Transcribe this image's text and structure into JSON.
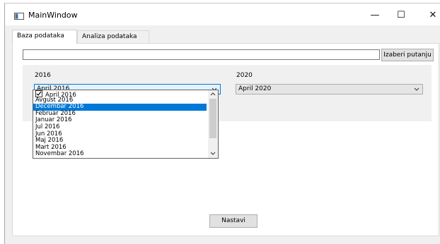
{
  "window": {
    "title": "MainWindow",
    "minimize_glyph": "—",
    "maximize_glyph": "☐",
    "close_glyph": "✕",
    "icon": "app-window-icon"
  },
  "tabs": [
    {
      "label": "Baza podataka",
      "active": true
    },
    {
      "label": "Analiza podataka",
      "active": false
    }
  ],
  "path_input": {
    "value": "",
    "placeholder": ""
  },
  "browse_button": {
    "label": "Izaberi putanju"
  },
  "left_group": {
    "label": "2016",
    "selected": "April 2016",
    "options": [
      {
        "label": "April 2016",
        "checked": true
      },
      {
        "label": "Avgust 2016"
      },
      {
        "label": "Decembar 2016",
        "highlighted": true
      },
      {
        "label": "Februar 2016"
      },
      {
        "label": "Januar 2016"
      },
      {
        "label": "Jul 2016"
      },
      {
        "label": "Jun 2016"
      },
      {
        "label": "Maj 2016"
      },
      {
        "label": "Mart 2016"
      },
      {
        "label": "Novembar 2016"
      }
    ]
  },
  "right_group": {
    "label": "2020",
    "selected": "April 2020"
  },
  "next_button": {
    "label": "Nastavi"
  },
  "colors": {
    "accent": "#0078d7",
    "highlight_text": "#ffffff"
  }
}
